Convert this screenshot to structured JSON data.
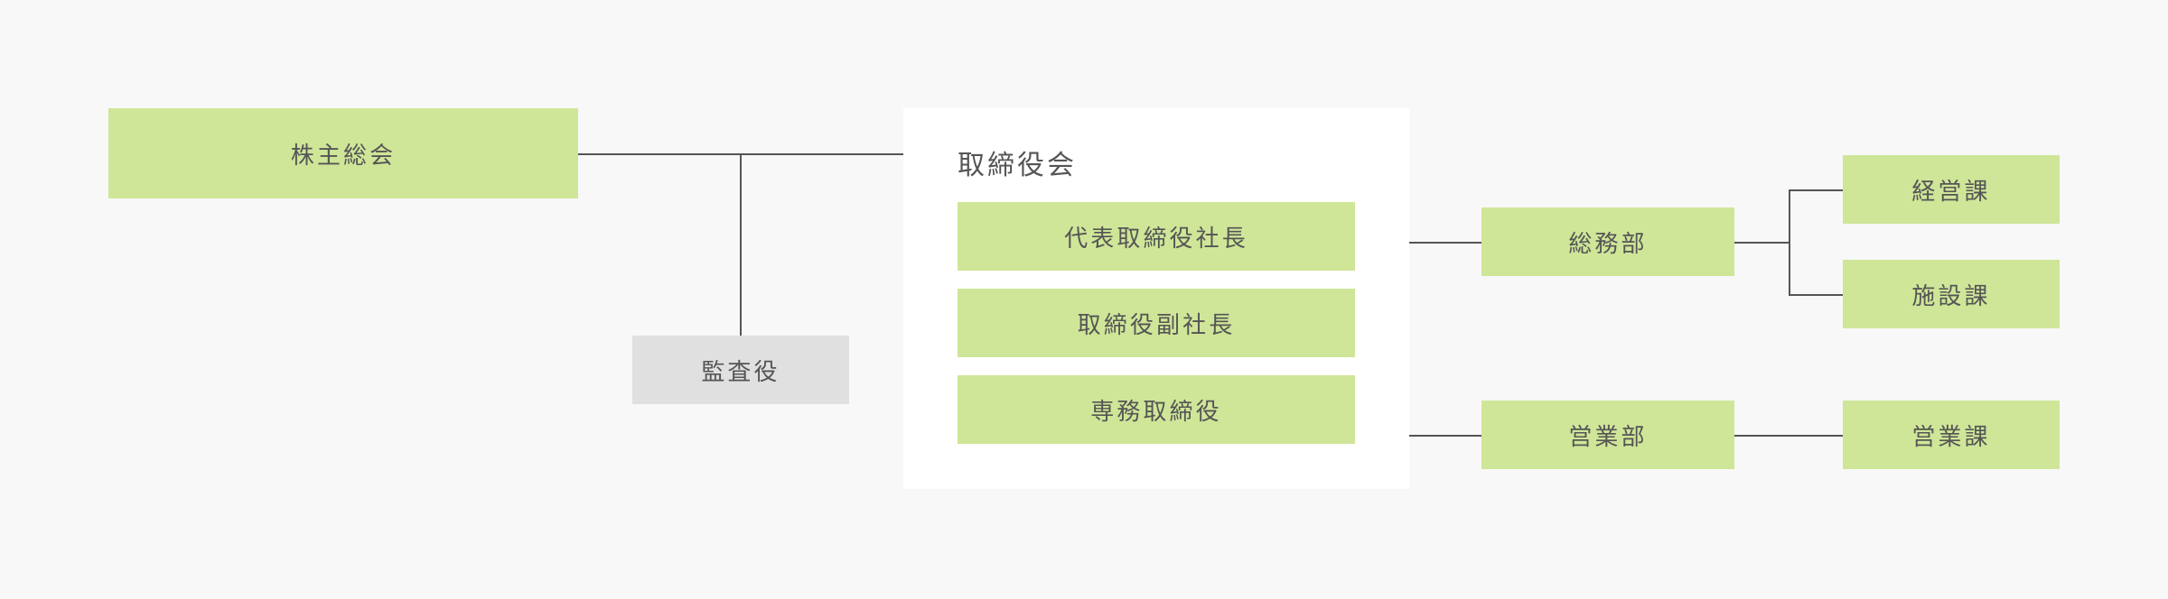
{
  "colors": {
    "node": "#cfe698",
    "auditor": "#e0e0e0",
    "line": "#555555",
    "background": "#f8f8f8",
    "panel": "#ffffff"
  },
  "shareholders": "株主総会",
  "auditor": "監査役",
  "board": {
    "title": "取締役会",
    "members": [
      "代表取締役社長",
      "取締役副社長",
      "専務取締役"
    ]
  },
  "departments": [
    {
      "name": "総務部",
      "sections": [
        "経営課",
        "施設課"
      ]
    },
    {
      "name": "営業部",
      "sections": [
        "営業課"
      ]
    }
  ]
}
